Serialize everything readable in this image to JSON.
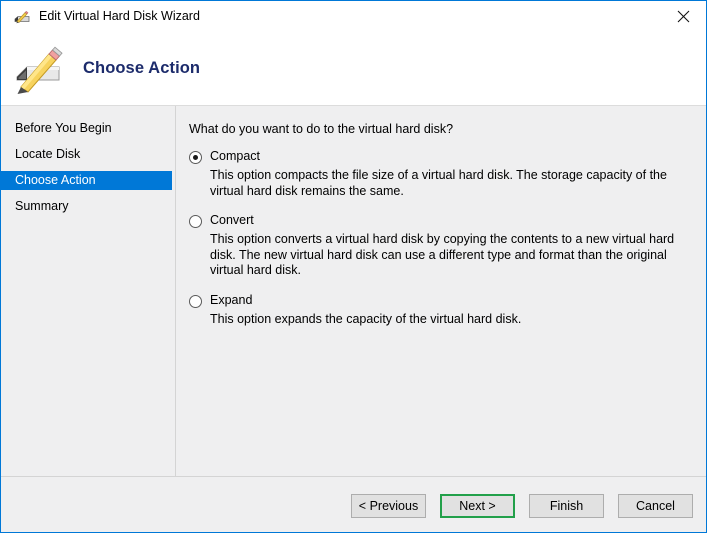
{
  "window": {
    "title": "Edit Virtual Hard Disk Wizard",
    "title_icon": "disk-pencil-icon",
    "close_icon": "close-icon"
  },
  "header": {
    "heading": "Choose Action",
    "icon": "hard-disk-pencil-icon"
  },
  "sidebar": {
    "items": [
      {
        "label": "Before You Begin",
        "selected": false
      },
      {
        "label": "Locate Disk",
        "selected": false
      },
      {
        "label": "Choose Action",
        "selected": true
      },
      {
        "label": "Summary",
        "selected": false
      }
    ]
  },
  "main": {
    "question": "What do you want to do to the virtual hard disk?",
    "options": [
      {
        "label": "Compact",
        "checked": true,
        "description": "This option compacts the file size of a virtual hard disk. The storage capacity of the virtual hard disk remains the same."
      },
      {
        "label": "Convert",
        "checked": false,
        "description": "This option converts a virtual hard disk by copying the contents to a new virtual hard disk. The new virtual hard disk can use a different type and format than the original virtual hard disk."
      },
      {
        "label": "Expand",
        "checked": false,
        "description": "This option expands the capacity of the virtual hard disk."
      }
    ]
  },
  "footer": {
    "buttons": [
      {
        "label": "< Previous",
        "highlighted": false
      },
      {
        "label": "Next >",
        "highlighted": true
      },
      {
        "label": "Finish",
        "highlighted": false
      },
      {
        "label": "Cancel",
        "highlighted": false
      }
    ]
  },
  "colors": {
    "window_border": "#0078d7",
    "selection": "#0078d7",
    "body_background": "#efeff0",
    "heading_text": "#1c2b6b",
    "highlight_outline": "#22a04a"
  }
}
